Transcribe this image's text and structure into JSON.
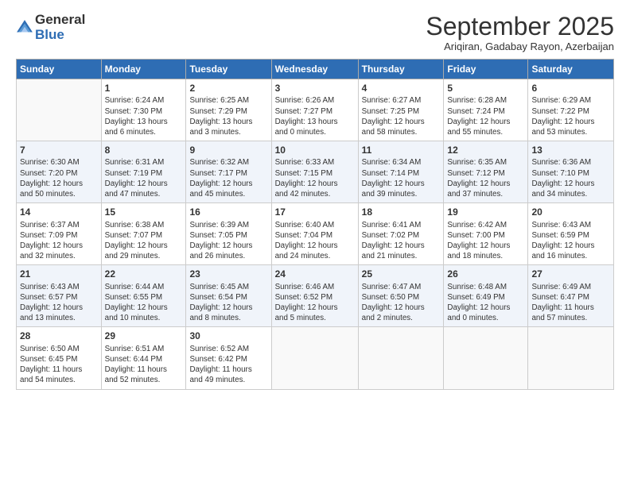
{
  "logo": {
    "general": "General",
    "blue": "Blue"
  },
  "title": "September 2025",
  "subtitle": "Ariqiran, Gadabay Rayon, Azerbaijan",
  "days_header": [
    "Sunday",
    "Monday",
    "Tuesday",
    "Wednesday",
    "Thursday",
    "Friday",
    "Saturday"
  ],
  "weeks": [
    [
      {
        "num": "",
        "info": ""
      },
      {
        "num": "1",
        "info": "Sunrise: 6:24 AM\nSunset: 7:30 PM\nDaylight: 13 hours\nand 6 minutes."
      },
      {
        "num": "2",
        "info": "Sunrise: 6:25 AM\nSunset: 7:29 PM\nDaylight: 13 hours\nand 3 minutes."
      },
      {
        "num": "3",
        "info": "Sunrise: 6:26 AM\nSunset: 7:27 PM\nDaylight: 13 hours\nand 0 minutes."
      },
      {
        "num": "4",
        "info": "Sunrise: 6:27 AM\nSunset: 7:25 PM\nDaylight: 12 hours\nand 58 minutes."
      },
      {
        "num": "5",
        "info": "Sunrise: 6:28 AM\nSunset: 7:24 PM\nDaylight: 12 hours\nand 55 minutes."
      },
      {
        "num": "6",
        "info": "Sunrise: 6:29 AM\nSunset: 7:22 PM\nDaylight: 12 hours\nand 53 minutes."
      }
    ],
    [
      {
        "num": "7",
        "info": "Sunrise: 6:30 AM\nSunset: 7:20 PM\nDaylight: 12 hours\nand 50 minutes."
      },
      {
        "num": "8",
        "info": "Sunrise: 6:31 AM\nSunset: 7:19 PM\nDaylight: 12 hours\nand 47 minutes."
      },
      {
        "num": "9",
        "info": "Sunrise: 6:32 AM\nSunset: 7:17 PM\nDaylight: 12 hours\nand 45 minutes."
      },
      {
        "num": "10",
        "info": "Sunrise: 6:33 AM\nSunset: 7:15 PM\nDaylight: 12 hours\nand 42 minutes."
      },
      {
        "num": "11",
        "info": "Sunrise: 6:34 AM\nSunset: 7:14 PM\nDaylight: 12 hours\nand 39 minutes."
      },
      {
        "num": "12",
        "info": "Sunrise: 6:35 AM\nSunset: 7:12 PM\nDaylight: 12 hours\nand 37 minutes."
      },
      {
        "num": "13",
        "info": "Sunrise: 6:36 AM\nSunset: 7:10 PM\nDaylight: 12 hours\nand 34 minutes."
      }
    ],
    [
      {
        "num": "14",
        "info": "Sunrise: 6:37 AM\nSunset: 7:09 PM\nDaylight: 12 hours\nand 32 minutes."
      },
      {
        "num": "15",
        "info": "Sunrise: 6:38 AM\nSunset: 7:07 PM\nDaylight: 12 hours\nand 29 minutes."
      },
      {
        "num": "16",
        "info": "Sunrise: 6:39 AM\nSunset: 7:05 PM\nDaylight: 12 hours\nand 26 minutes."
      },
      {
        "num": "17",
        "info": "Sunrise: 6:40 AM\nSunset: 7:04 PM\nDaylight: 12 hours\nand 24 minutes."
      },
      {
        "num": "18",
        "info": "Sunrise: 6:41 AM\nSunset: 7:02 PM\nDaylight: 12 hours\nand 21 minutes."
      },
      {
        "num": "19",
        "info": "Sunrise: 6:42 AM\nSunset: 7:00 PM\nDaylight: 12 hours\nand 18 minutes."
      },
      {
        "num": "20",
        "info": "Sunrise: 6:43 AM\nSunset: 6:59 PM\nDaylight: 12 hours\nand 16 minutes."
      }
    ],
    [
      {
        "num": "21",
        "info": "Sunrise: 6:43 AM\nSunset: 6:57 PM\nDaylight: 12 hours\nand 13 minutes."
      },
      {
        "num": "22",
        "info": "Sunrise: 6:44 AM\nSunset: 6:55 PM\nDaylight: 12 hours\nand 10 minutes."
      },
      {
        "num": "23",
        "info": "Sunrise: 6:45 AM\nSunset: 6:54 PM\nDaylight: 12 hours\nand 8 minutes."
      },
      {
        "num": "24",
        "info": "Sunrise: 6:46 AM\nSunset: 6:52 PM\nDaylight: 12 hours\nand 5 minutes."
      },
      {
        "num": "25",
        "info": "Sunrise: 6:47 AM\nSunset: 6:50 PM\nDaylight: 12 hours\nand 2 minutes."
      },
      {
        "num": "26",
        "info": "Sunrise: 6:48 AM\nSunset: 6:49 PM\nDaylight: 12 hours\nand 0 minutes."
      },
      {
        "num": "27",
        "info": "Sunrise: 6:49 AM\nSunset: 6:47 PM\nDaylight: 11 hours\nand 57 minutes."
      }
    ],
    [
      {
        "num": "28",
        "info": "Sunrise: 6:50 AM\nSunset: 6:45 PM\nDaylight: 11 hours\nand 54 minutes."
      },
      {
        "num": "29",
        "info": "Sunrise: 6:51 AM\nSunset: 6:44 PM\nDaylight: 11 hours\nand 52 minutes."
      },
      {
        "num": "30",
        "info": "Sunrise: 6:52 AM\nSunset: 6:42 PM\nDaylight: 11 hours\nand 49 minutes."
      },
      {
        "num": "",
        "info": ""
      },
      {
        "num": "",
        "info": ""
      },
      {
        "num": "",
        "info": ""
      },
      {
        "num": "",
        "info": ""
      }
    ]
  ]
}
